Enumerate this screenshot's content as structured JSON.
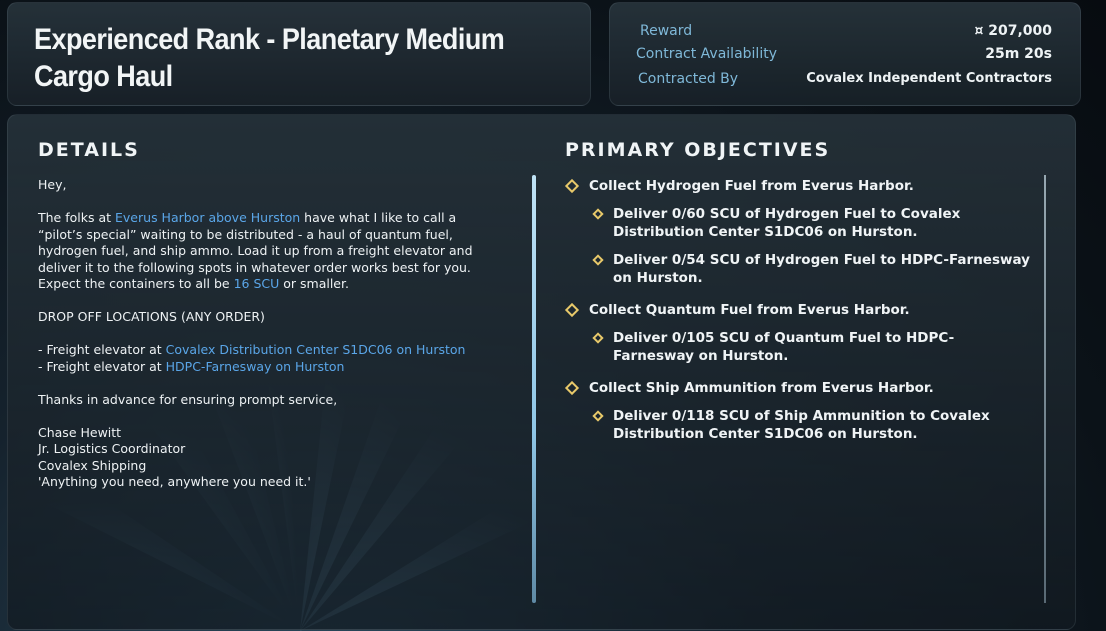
{
  "header": {
    "title": "Experienced Rank - Planetary Medium Cargo Haul"
  },
  "contract": {
    "reward_label": "Reward",
    "reward_value": "¤ 207,000",
    "availability_label": "Contract Availability",
    "availability_value": "25m 20s",
    "contracted_by_label": "Contracted By",
    "contracted_by_value": "Covalex Independent Contractors"
  },
  "details": {
    "heading": "DETAILS",
    "greeting": "Hey,",
    "p1_a": "The folks at ",
    "p1_link": "Everus Harbor above Hurston",
    "p1_b": " have what I like to call a “pilot’s special” waiting to be distributed - a haul of quantum fuel, hydrogen fuel, and ship ammo. Load it up from a freight elevator and deliver it to the following spots in whatever order works best for you. Expect the containers to all be ",
    "p1_scu": "16 SCU",
    "p1_c": " or smaller.",
    "dropoff_heading": "DROP OFF LOCATIONS (ANY ORDER)",
    "drop1_prefix": "- Freight elevator at ",
    "drop1_link": "Covalex Distribution Center S1DC06 on Hurston",
    "drop2_prefix": "- Freight elevator at ",
    "drop2_link": "HDPC-Farnesway on Hurston",
    "thanks": "Thanks in advance for ensuring prompt service,",
    "sig_name": "Chase Hewitt",
    "sig_title": "Jr. Logistics Coordinator",
    "sig_company": "Covalex Shipping",
    "sig_motto": "'Anything you need, anywhere you need it.'"
  },
  "objectives": {
    "heading": "PRIMARY OBJECTIVES",
    "groups": [
      {
        "label": "Collect Hydrogen Fuel from Everus Harbor.",
        "subs": [
          "Deliver 0/60 SCU of Hydrogen Fuel to Covalex Distribution Center S1DC06 on Hurston.",
          "Deliver 0/54 SCU of Hydrogen Fuel to HDPC-Farnesway on Hurston."
        ]
      },
      {
        "label": "Collect Quantum Fuel from Everus Harbor.",
        "subs": [
          "Deliver 0/105 SCU of Quantum Fuel to HDPC-Farnesway on Hurston."
        ]
      },
      {
        "label": "Collect Ship Ammunition from Everus Harbor.",
        "subs": [
          "Deliver 0/118 SCU of Ship Ammunition to Covalex Distribution Center S1DC06 on Hurston."
        ]
      }
    ]
  },
  "colors": {
    "accent_link": "#5aa6e8",
    "label_blue": "#7fb8d8",
    "objective_diamond": "#e8c96a"
  }
}
